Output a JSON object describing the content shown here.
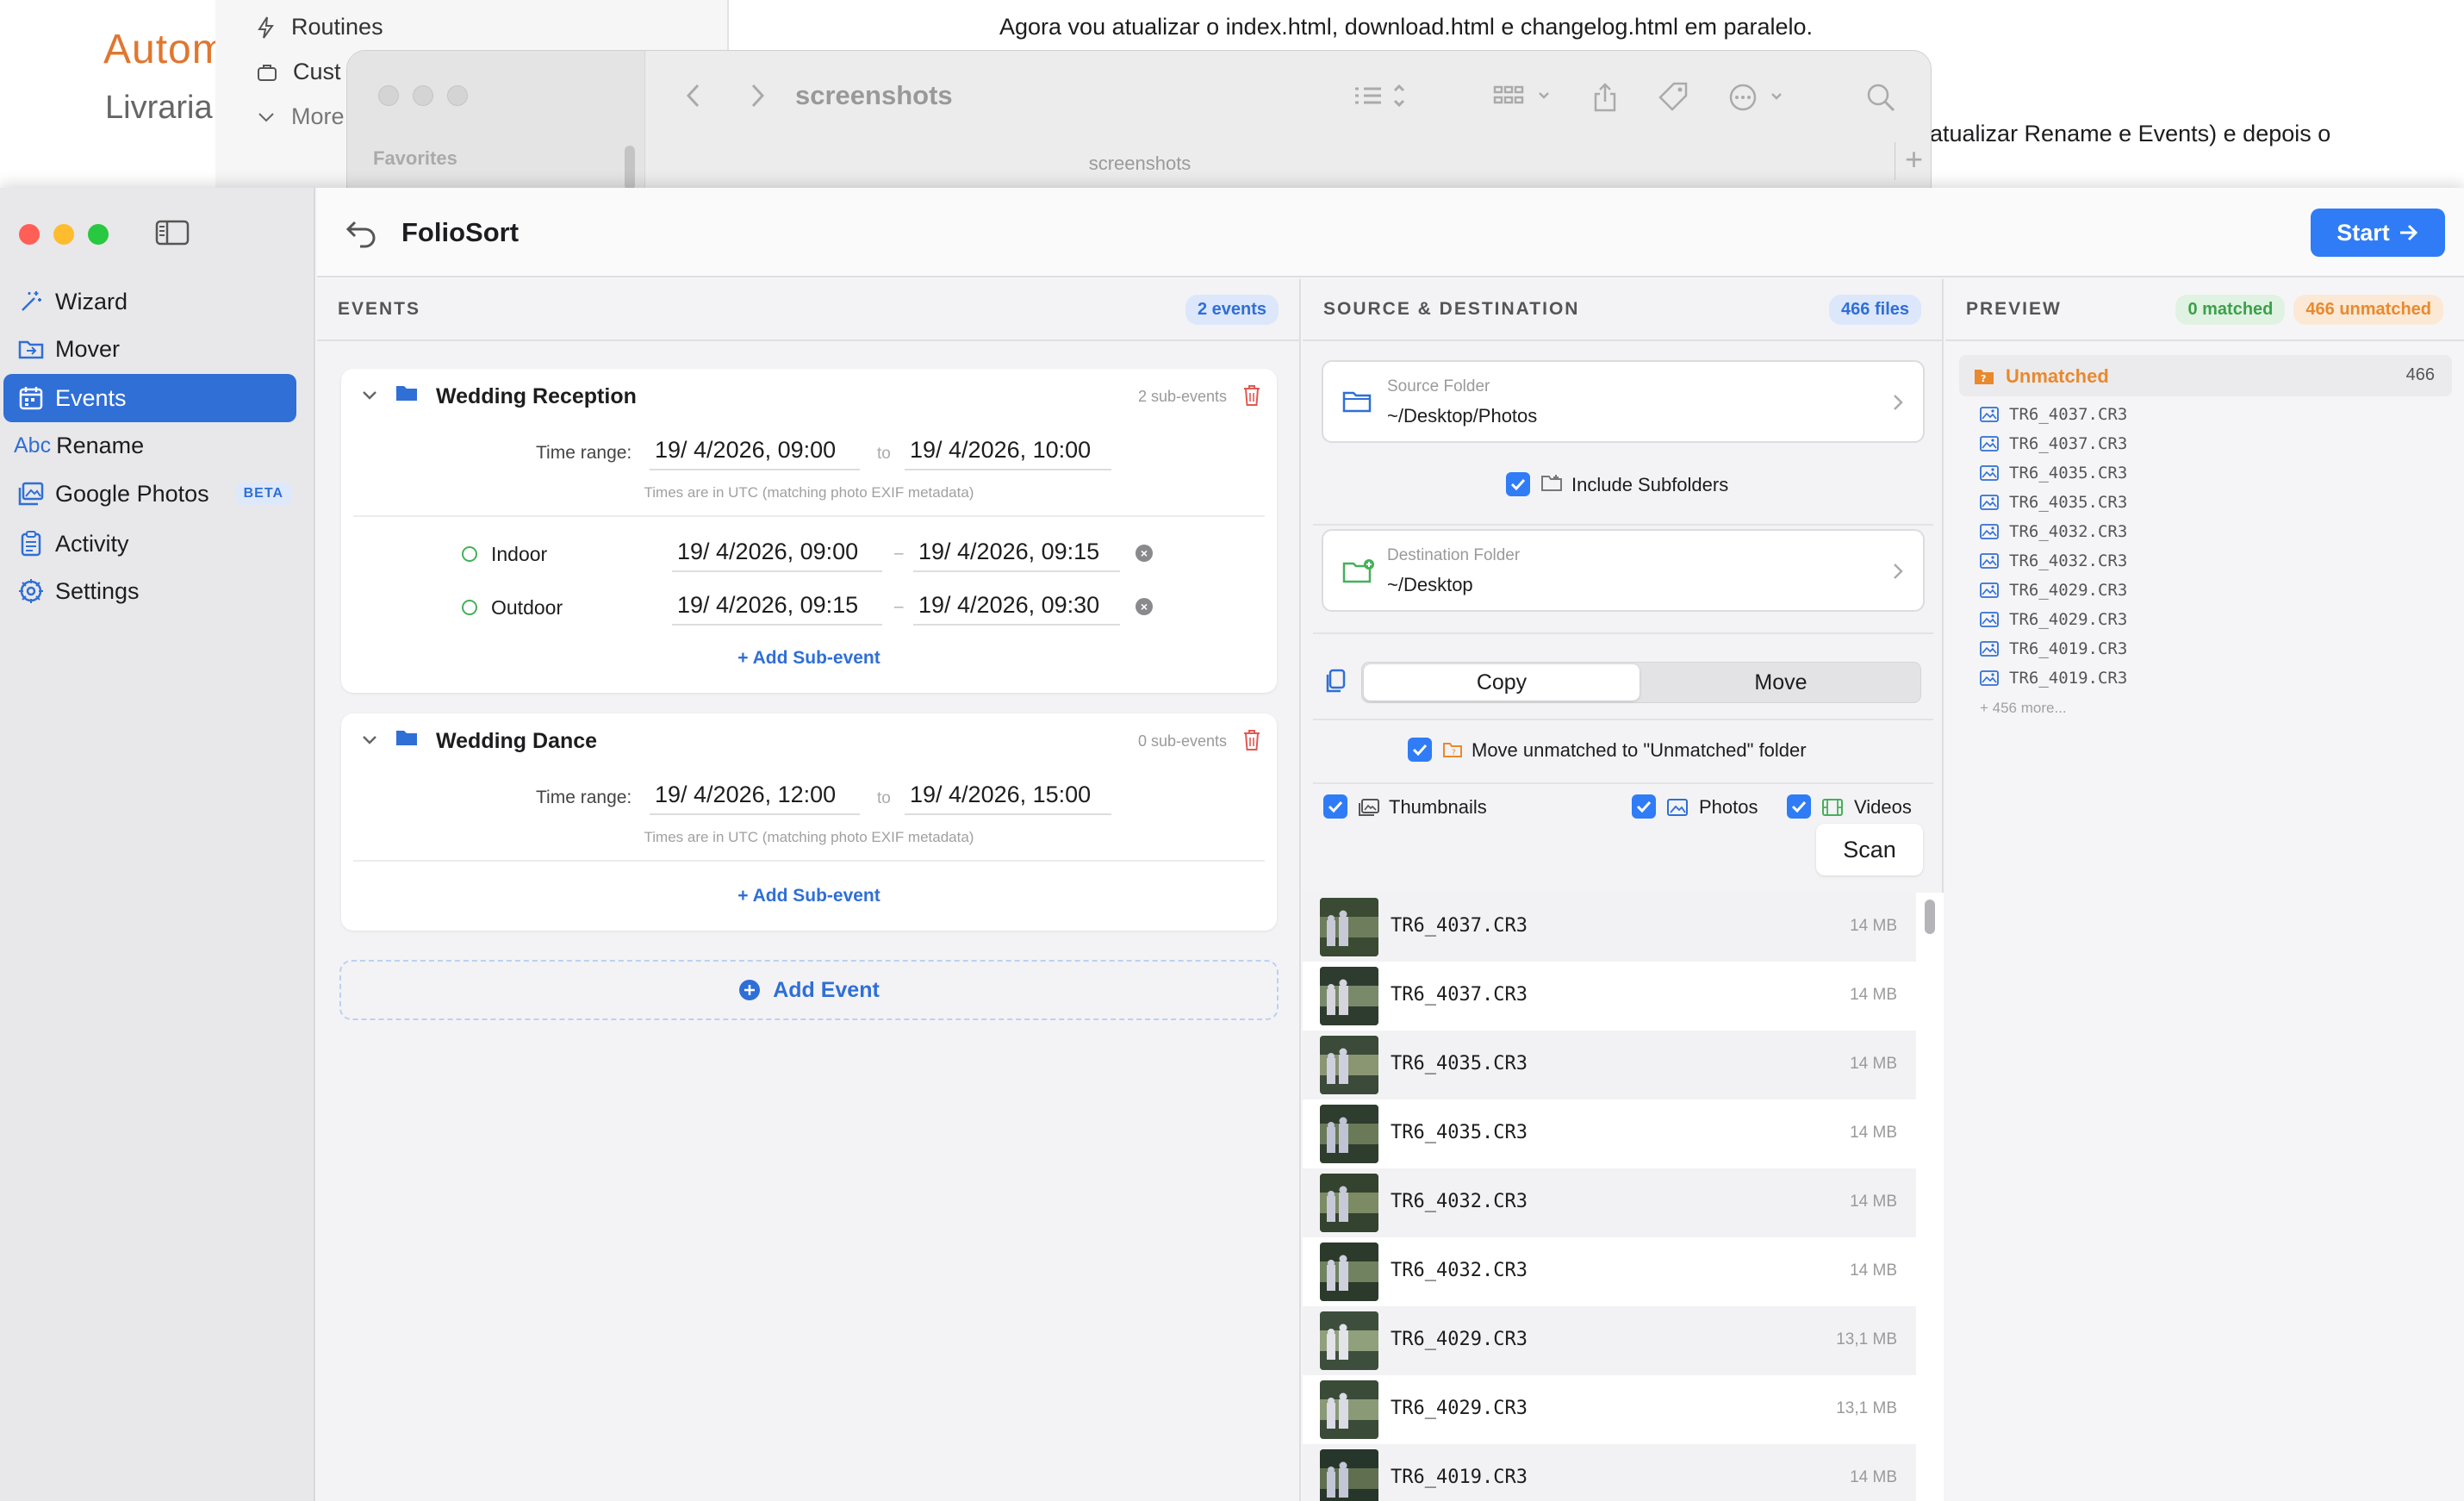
{
  "background": {
    "brand_title": "Autom",
    "brand_subtitle": "Livraria",
    "sidebar_items": [
      "Routines",
      "Cust",
      "More"
    ],
    "doc_line1": "Agora vou atualizar o index.html, download.html e changelog.html em paralelo.",
    "doc_line2": "atualizar Rename e Events) e depois o"
  },
  "finder": {
    "favorites_label": "Favorites",
    "title": "screenshots",
    "tab_label": "screenshots"
  },
  "app": {
    "title": "FolioSort",
    "start_label": "Start"
  },
  "sidebar": {
    "items": [
      {
        "label": "Wizard",
        "icon": "wand-icon"
      },
      {
        "label": "Mover",
        "icon": "folder-move-icon"
      },
      {
        "label": "Events",
        "icon": "calendar-icon",
        "selected": true
      },
      {
        "label": "Rename",
        "icon": "abc-icon"
      },
      {
        "label": "Google Photos",
        "icon": "photos-icon",
        "badge": "BETA"
      },
      {
        "label": "Activity",
        "icon": "clipboard-icon"
      },
      {
        "label": "Settings",
        "icon": "gear-icon"
      }
    ],
    "rename_prefix": "Abc"
  },
  "events": {
    "header": "EVENTS",
    "count_badge": "2 events",
    "time_range_label": "Time range:",
    "to_label": "to",
    "utc_note": "Times are in UTC (matching photo EXIF metadata)",
    "add_sub_event": "Add Sub-event",
    "add_event": "Add Event",
    "list": [
      {
        "name": "Wedding Reception",
        "sub_count": "2 sub-events",
        "start": "19/  4/2026, 09:00",
        "end": "19/  4/2026, 10:00",
        "subs": [
          {
            "name": "Indoor",
            "start": "19/  4/2026, 09:00",
            "end": "19/  4/2026, 09:15"
          },
          {
            "name": "Outdoor",
            "start": "19/  4/2026, 09:15",
            "end": "19/  4/2026, 09:30"
          }
        ]
      },
      {
        "name": "Wedding Dance",
        "sub_count": "0 sub-events",
        "start": "19/  4/2026, 12:00",
        "end": "19/  4/2026, 15:00",
        "subs": []
      }
    ]
  },
  "source": {
    "header": "SOURCE & DESTINATION",
    "files_badge": "466 files",
    "source_label": "Source Folder",
    "source_path": "~/Desktop/Photos",
    "include_subfolders": "Include Subfolders",
    "dest_label": "Destination Folder",
    "dest_path": "~/Desktop",
    "mode_copy": "Copy",
    "mode_move": "Move",
    "mode_selected": "Copy",
    "move_unmatched": "Move unmatched to \"Unmatched\" folder",
    "thumbnails": "Thumbnails",
    "photos": "Photos",
    "videos": "Videos",
    "scan": "Scan",
    "files": [
      {
        "name": "TR6_4037.CR3",
        "size": "14 MB"
      },
      {
        "name": "TR6_4037.CR3",
        "size": "14 MB"
      },
      {
        "name": "TR6_4035.CR3",
        "size": "14 MB"
      },
      {
        "name": "TR6_4035.CR3",
        "size": "14 MB"
      },
      {
        "name": "TR6_4032.CR3",
        "size": "14 MB"
      },
      {
        "name": "TR6_4032.CR3",
        "size": "14 MB"
      },
      {
        "name": "TR6_4029.CR3",
        "size": "13,1 MB"
      },
      {
        "name": "TR6_4029.CR3",
        "size": "13,1 MB"
      },
      {
        "name": "TR6_4019.CR3",
        "size": "14 MB"
      }
    ]
  },
  "preview": {
    "header": "PREVIEW",
    "matched_badge": "0 matched",
    "unmatched_badge": "466 unmatched",
    "unmatched_folder": "Unmatched",
    "unmatched_count": "466",
    "files": [
      "TR6_4037.CR3",
      "TR6_4037.CR3",
      "TR6_4035.CR3",
      "TR6_4035.CR3",
      "TR6_4032.CR3",
      "TR6_4032.CR3",
      "TR6_4029.CR3",
      "TR6_4029.CR3",
      "TR6_4019.CR3",
      "TR6_4019.CR3"
    ],
    "more": "+ 456 more..."
  },
  "colors": {
    "accent": "#2f7cf6",
    "selection": "#2f6fd6",
    "matched_green": "#3aa14a",
    "unmatched_orange": "#e9892d",
    "delete_red": "#e05a52"
  }
}
